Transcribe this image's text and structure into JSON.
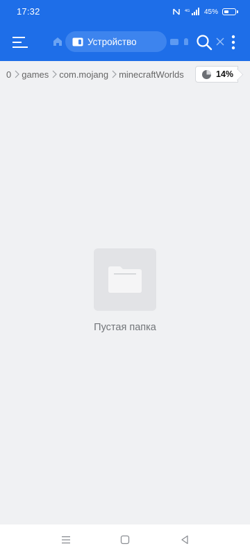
{
  "status_bar": {
    "time": "17:32",
    "battery_text": "45%"
  },
  "toolbar": {
    "device_tab_label": "Устройство"
  },
  "breadcrumb": {
    "items": [
      "0",
      "games",
      "com.mojang",
      "minecraftWorlds"
    ]
  },
  "storage": {
    "used_percent": "14%"
  },
  "empty_state": {
    "message": "Пустая папка"
  },
  "colors": {
    "accent": "#1e6ee8",
    "background": "#f0f1f3"
  },
  "icons": [
    "menu-icon",
    "home-icon",
    "device-icon",
    "close-icon",
    "search-icon",
    "more-icon",
    "pie-chart-icon",
    "folder-icon",
    "nav-menu-icon",
    "nav-home-icon",
    "nav-back-icon"
  ]
}
